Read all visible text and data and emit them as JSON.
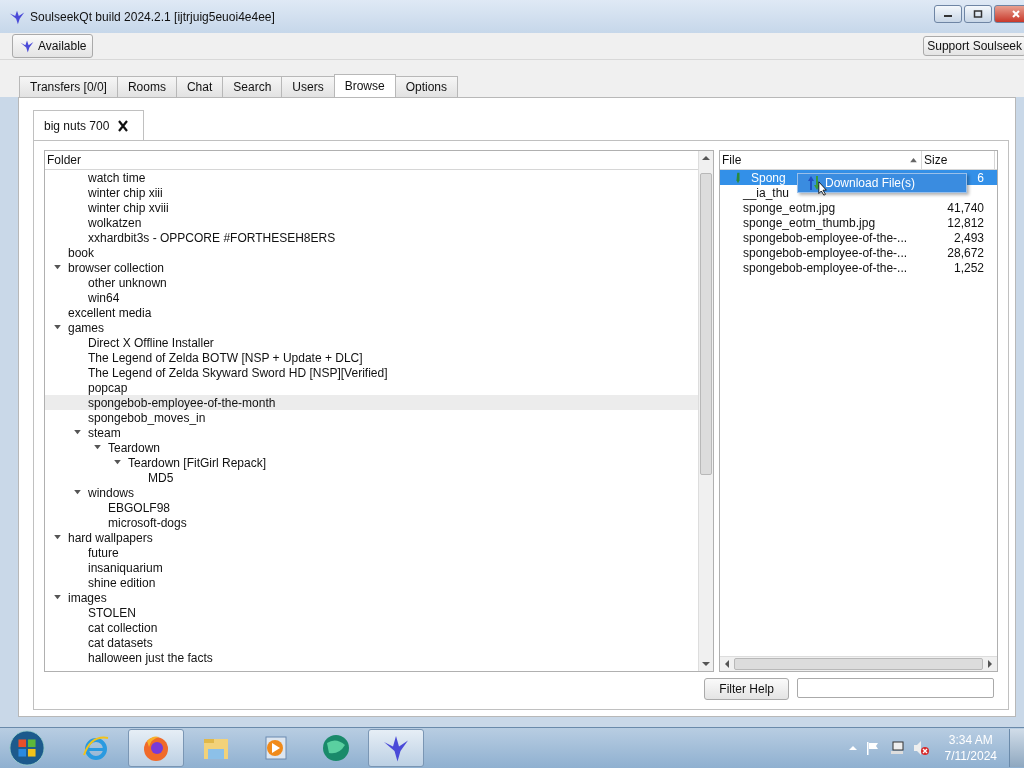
{
  "window": {
    "title": "SoulseekQt build 2024.2.1 [ijtrjuig5euoi4e4ee]"
  },
  "toolbar": {
    "status_button": "Available",
    "support_button": "Support Soulseek"
  },
  "tabs": [
    {
      "label": "Transfers [0/0]",
      "selected": false
    },
    {
      "label": "Rooms",
      "selected": false
    },
    {
      "label": "Chat",
      "selected": false
    },
    {
      "label": "Search",
      "selected": false
    },
    {
      "label": "Users",
      "selected": false
    },
    {
      "label": "Browse",
      "selected": true
    },
    {
      "label": "Options",
      "selected": false
    }
  ],
  "user_tabs": [
    {
      "label": "big nuts 700",
      "selected": true
    }
  ],
  "folder_tree": {
    "header": "Folder",
    "items": [
      {
        "children": [
          {
            "label": "watch time",
            "selected": false
          },
          {
            "label": "winter chip xiii",
            "selected": false
          },
          {
            "label": "winter chip xviii",
            "selected": false
          },
          {
            "label": "wolkatzen",
            "selected": false
          },
          {
            "label": "xxhardbit3s - OPPCORE #FORTHESEH8ERS",
            "selected": false
          }
        ]
      },
      {
        "label": "book",
        "selected": false
      },
      {
        "label": "browser collection",
        "selected": false,
        "expanded": true,
        "children": [
          {
            "label": "other unknown",
            "selected": false
          },
          {
            "label": "win64",
            "selected": false
          }
        ]
      },
      {
        "label": "excellent media",
        "selected": false
      },
      {
        "label": "games",
        "selected": false,
        "expanded": true,
        "children": [
          {
            "label": "Direct X Offline Installer",
            "selected": false
          },
          {
            "label": "The Legend of Zelda BOTW [NSP + Update + DLC]",
            "selected": false
          },
          {
            "label": "The Legend of Zelda Skyward Sword HD [NSP][Verified]",
            "selected": false
          },
          {
            "label": "popcap",
            "selected": false
          },
          {
            "label": "spongebob-employee-of-the-month",
            "selected": true
          },
          {
            "label": "spongebob_moves_in",
            "selected": false
          },
          {
            "label": "steam",
            "selected": false,
            "expanded": true,
            "children": [
              {
                "label": "Teardown",
                "selected": false,
                "expanded": true,
                "children": [
                  {
                    "label": "Teardown [FitGirl Repack]",
                    "selected": false,
                    "expanded": true,
                    "children": [
                      {
                        "label": "MD5",
                        "selected": false
                      }
                    ]
                  }
                ]
              }
            ]
          },
          {
            "label": "windows",
            "selected": false,
            "expanded": true,
            "children": [
              {
                "label": "EBGOLF98",
                "selected": false
              },
              {
                "label": "microsoft-dogs",
                "selected": false
              }
            ]
          }
        ]
      },
      {
        "label": "hard wallpapers",
        "selected": false,
        "expanded": true,
        "children": [
          {
            "label": "future",
            "selected": false
          },
          {
            "label": "insaniquarium",
            "selected": false
          },
          {
            "label": "shine edition",
            "selected": false
          }
        ]
      },
      {
        "label": "images",
        "selected": false,
        "expanded": true,
        "children": [
          {
            "label": "STOLEN",
            "selected": false
          },
          {
            "label": "cat collection",
            "selected": false
          },
          {
            "label": "cat datasets",
            "selected": false
          },
          {
            "label": "halloween just the facts",
            "selected": false
          }
        ]
      }
    ]
  },
  "file_list": {
    "columns": [
      {
        "label": "File",
        "sorted": true
      },
      {
        "label": "Size",
        "sorted": false
      }
    ],
    "rows": [
      {
        "name": "Spong",
        "size": "6",
        "selected": true
      },
      {
        "name": "__ia_thu",
        "selected": false
      },
      {
        "name": "sponge_eotm.jpg",
        "size": "41,740",
        "selected": false
      },
      {
        "name": "sponge_eotm_thumb.jpg",
        "size": "12,812",
        "selected": false
      },
      {
        "name": "spongebob-employee-of-the-...",
        "size": "2,493",
        "selected": false
      },
      {
        "name": "spongebob-employee-of-the-...",
        "size": "28,672",
        "selected": false
      },
      {
        "name": "spongebob-employee-of-the-...",
        "size": "1,252",
        "selected": false
      }
    ]
  },
  "context_menu": {
    "items": [
      {
        "label": "Download File(s)",
        "selected": true
      }
    ]
  },
  "filter": {
    "button": "Filter Help"
  },
  "taskbar": {
    "apps": [
      {
        "kind": "ie",
        "active": false
      },
      {
        "kind": "firefox",
        "active": true
      },
      {
        "kind": "explorer",
        "active": false
      },
      {
        "kind": "media",
        "active": false
      },
      {
        "kind": "globe",
        "active": false
      },
      {
        "kind": "bird",
        "active": true
      }
    ],
    "clock": {
      "time": "3:34 AM",
      "date": "7/11/2024"
    }
  }
}
